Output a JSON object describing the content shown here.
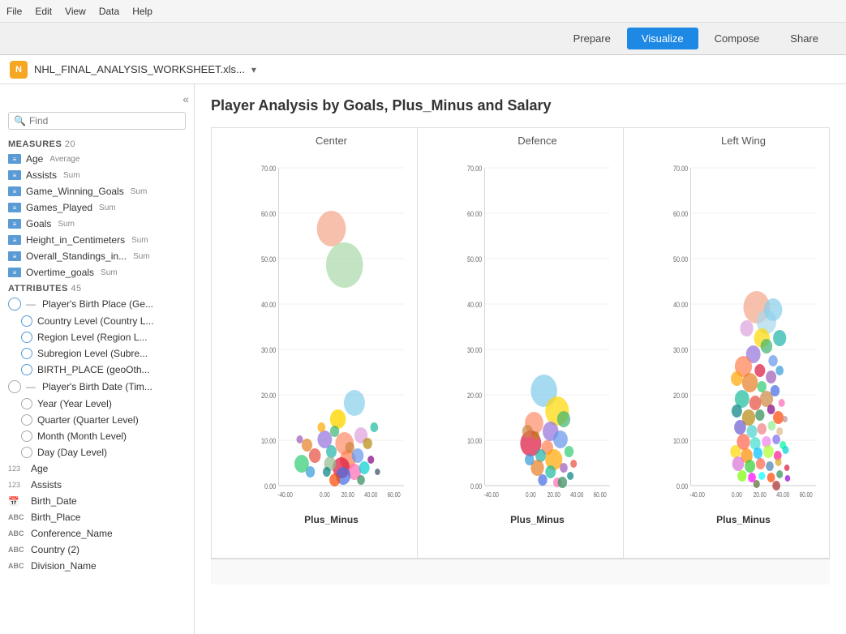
{
  "menu": {
    "items": [
      "File",
      "Edit",
      "View",
      "Data",
      "Help"
    ]
  },
  "topnav": {
    "buttons": [
      "Prepare",
      "Visualize",
      "Compose",
      "Share"
    ],
    "active": "Visualize"
  },
  "filebar": {
    "filename": "NHL_FINAL_ANALYSIS_WORKSHEET.xls...",
    "icon_text": "N"
  },
  "sidebar": {
    "search_placeholder": "Find",
    "measures_label": "MEASURES",
    "measures_count": "20",
    "attributes_label": "ATTRIBUTES",
    "attributes_count": "45",
    "measures": [
      {
        "name": "Age",
        "tag": "Average"
      },
      {
        "name": "Assists",
        "tag": "Sum"
      },
      {
        "name": "Game_Winning_Goals",
        "tag": "Sum"
      },
      {
        "name": "Games_Played",
        "tag": "Sum"
      },
      {
        "name": "Goals",
        "tag": "Sum"
      },
      {
        "name": "Height_in_Centimeters",
        "tag": "Sum"
      },
      {
        "name": "Overall_Standings_in...",
        "tag": "Sum"
      },
      {
        "name": "Overtime_goals",
        "tag": "Sum"
      }
    ],
    "attributes": [
      {
        "type": "geo",
        "indent": 0,
        "dash": "—",
        "name": "Player's Birth Place (Ge..."
      },
      {
        "type": "globe",
        "indent": 1,
        "name": "Country Level (Country L..."
      },
      {
        "type": "globe",
        "indent": 1,
        "name": "Region Level (Region L..."
      },
      {
        "type": "globe",
        "indent": 1,
        "name": "Subregion Level (Subre..."
      },
      {
        "type": "globe",
        "indent": 1,
        "name": "BIRTH_PLACE (geoOth..."
      },
      {
        "type": "time",
        "indent": 0,
        "dash": "—",
        "name": "Player's Birth Date (Tim..."
      },
      {
        "type": "clock",
        "indent": 1,
        "name": "Year (Year Level)"
      },
      {
        "type": "clock",
        "indent": 1,
        "name": "Quarter (Quarter Level)"
      },
      {
        "type": "clock",
        "indent": 1,
        "name": "Month (Month Level)"
      },
      {
        "type": "clock",
        "indent": 1,
        "name": "Day (Day Level)"
      },
      {
        "type": "123",
        "indent": 0,
        "name": "Age"
      },
      {
        "type": "123",
        "indent": 0,
        "name": "Assists"
      },
      {
        "type": "cal",
        "indent": 0,
        "name": "Birth_Date"
      },
      {
        "type": "abc",
        "indent": 0,
        "name": "Birth_Place"
      },
      {
        "type": "abc",
        "indent": 0,
        "name": "Conference_Name"
      },
      {
        "type": "abc",
        "indent": 0,
        "name": "Country (2)"
      },
      {
        "type": "abc",
        "indent": 0,
        "name": "Division_Name"
      }
    ]
  },
  "chart": {
    "title": "Player Analysis by Goals, Plus_Minus and Salary",
    "panels": [
      {
        "label": "Center",
        "x_axis": "Plus_Minus"
      },
      {
        "label": "Defence",
        "x_axis": "Plus_Minus"
      },
      {
        "label": "Left Wing",
        "x_axis": "Plus_Minus"
      }
    ],
    "y_ticks": [
      "0.00",
      "10.00",
      "20.00",
      "30.00",
      "40.00",
      "50.00",
      "60.00",
      "70.00"
    ],
    "x_ticks": [
      "-40.00",
      "0.00",
      "20.00",
      "40.00",
      "60.00"
    ]
  }
}
